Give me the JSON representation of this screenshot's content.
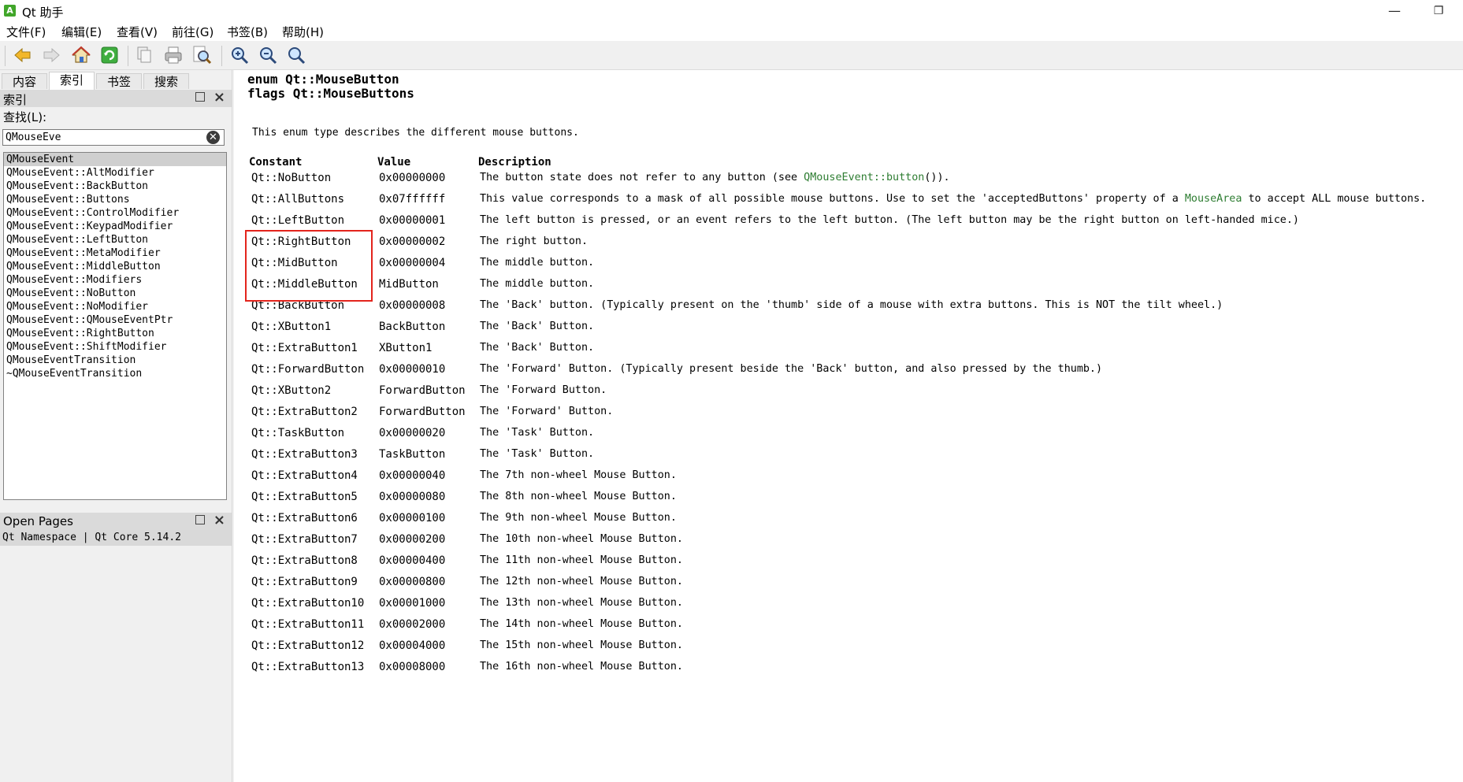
{
  "window": {
    "icon_letter": "A",
    "title": "Qt 助手",
    "minimize_glyph": "—",
    "maximize_glyph": "❐"
  },
  "menu": [
    "文件(F)",
    "编辑(E)",
    "查看(V)",
    "前往(G)",
    "书签(B)",
    "帮助(H)"
  ],
  "toolbar": {
    "buttons": [
      "back-icon",
      "forward-icon",
      "home-icon",
      "sync-icon",
      "copy-icon",
      "print-icon",
      "find-icon",
      "zoom-in-icon",
      "zoom-out-icon",
      "zoom-reset-icon"
    ]
  },
  "sidebar": {
    "tabs": [
      "内容",
      "索引",
      "书签",
      "搜索"
    ],
    "active_tab": "索引",
    "index_title": "索引",
    "find_label": "查找(L):",
    "search_value": "QMouseEve",
    "clear_glyph": "✕",
    "close_glyph": "×",
    "index_items": [
      "QMouseEvent",
      "QMouseEvent::AltModifier",
      "QMouseEvent::BackButton",
      "QMouseEvent::Buttons",
      "QMouseEvent::ControlModifier",
      "QMouseEvent::KeypadModifier",
      "QMouseEvent::LeftButton",
      "QMouseEvent::MetaModifier",
      "QMouseEvent::MiddleButton",
      "QMouseEvent::Modifiers",
      "QMouseEvent::NoButton",
      "QMouseEvent::NoModifier",
      "QMouseEvent::QMouseEventPtr",
      "QMouseEvent::RightButton",
      "QMouseEvent::ShiftModifier",
      "QMouseEventTransition",
      "~QMouseEventTransition"
    ],
    "open_pages_title": "Open Pages",
    "open_page": "Qt Namespace | Qt Core 5.14.2"
  },
  "doc": {
    "heading1": "enum Qt::MouseButton",
    "heading2": "flags Qt::MouseButtons",
    "description": "This enum type describes the different mouse buttons.",
    "columns": [
      "Constant",
      "Value",
      "Description"
    ],
    "rows": [
      {
        "constant": "Qt::NoButton",
        "value": "0x00000000",
        "desc": "The button state does not refer to any button (see ",
        "link": "QMouseEvent::button",
        "desc_after": "())."
      },
      {
        "constant": "Qt::AllButtons",
        "value": "0x07ffffff",
        "desc": "This value corresponds to a mask of all possible mouse buttons. Use to set the 'acceptedButtons' property of a ",
        "link": "MouseArea",
        "desc_after": " to accept ALL mouse buttons."
      },
      {
        "constant": "Qt::LeftButton",
        "value": "0x00000001",
        "desc": "The left button is pressed, or an event refers to the left button. (The left button may be the right button on left-handed mice.)"
      },
      {
        "constant": "Qt::RightButton",
        "value": "0x00000002",
        "desc": "The right button."
      },
      {
        "constant": "Qt::MidButton",
        "value": "0x00000004",
        "desc": "The middle button."
      },
      {
        "constant": "Qt::MiddleButton",
        "value": "MidButton",
        "desc": "The middle button."
      },
      {
        "constant": "Qt::BackButton",
        "value": "0x00000008",
        "desc": "The 'Back' button. (Typically present on the 'thumb' side of a mouse with extra buttons. This is NOT the tilt wheel.)"
      },
      {
        "constant": "Qt::XButton1",
        "value": "BackButton",
        "desc": "The 'Back' Button."
      },
      {
        "constant": "Qt::ExtraButton1",
        "value": "XButton1",
        "desc": "The 'Back' Button."
      },
      {
        "constant": "Qt::ForwardButton",
        "value": "0x00000010",
        "desc": "The 'Forward' Button. (Typically present beside the 'Back' button, and also pressed by the thumb.)"
      },
      {
        "constant": "Qt::XButton2",
        "value": "ForwardButton",
        "desc": "The 'Forward Button."
      },
      {
        "constant": "Qt::ExtraButton2",
        "value": "ForwardButton",
        "desc": "The 'Forward' Button."
      },
      {
        "constant": "Qt::TaskButton",
        "value": "0x00000020",
        "desc": "The 'Task' Button."
      },
      {
        "constant": "Qt::ExtraButton3",
        "value": "TaskButton",
        "desc": "The 'Task' Button."
      },
      {
        "constant": "Qt::ExtraButton4",
        "value": "0x00000040",
        "desc": "The 7th non-wheel Mouse Button."
      },
      {
        "constant": "Qt::ExtraButton5",
        "value": "0x00000080",
        "desc": "The 8th non-wheel Mouse Button."
      },
      {
        "constant": "Qt::ExtraButton6",
        "value": "0x00000100",
        "desc": "The 9th non-wheel Mouse Button."
      },
      {
        "constant": "Qt::ExtraButton7",
        "value": "0x00000200",
        "desc": "The 10th non-wheel Mouse Button."
      },
      {
        "constant": "Qt::ExtraButton8",
        "value": "0x00000400",
        "desc": "The 11th non-wheel Mouse Button."
      },
      {
        "constant": "Qt::ExtraButton9",
        "value": "0x00000800",
        "desc": "The 12th non-wheel Mouse Button."
      },
      {
        "constant": "Qt::ExtraButton10",
        "value": "0x00001000",
        "desc": "The 13th non-wheel Mouse Button."
      },
      {
        "constant": "Qt::ExtraButton11",
        "value": "0x00002000",
        "desc": "The 14th non-wheel Mouse Button."
      },
      {
        "constant": "Qt::ExtraButton12",
        "value": "0x00004000",
        "desc": "The 15th non-wheel Mouse Button."
      },
      {
        "constant": "Qt::ExtraButton13",
        "value": "0x00008000",
        "desc": "The 16th non-wheel Mouse Button."
      }
    ]
  },
  "colors": {
    "link": "#2e7d32",
    "highlight_border": "#e3241c",
    "selected_row": "#cfcfcf"
  }
}
